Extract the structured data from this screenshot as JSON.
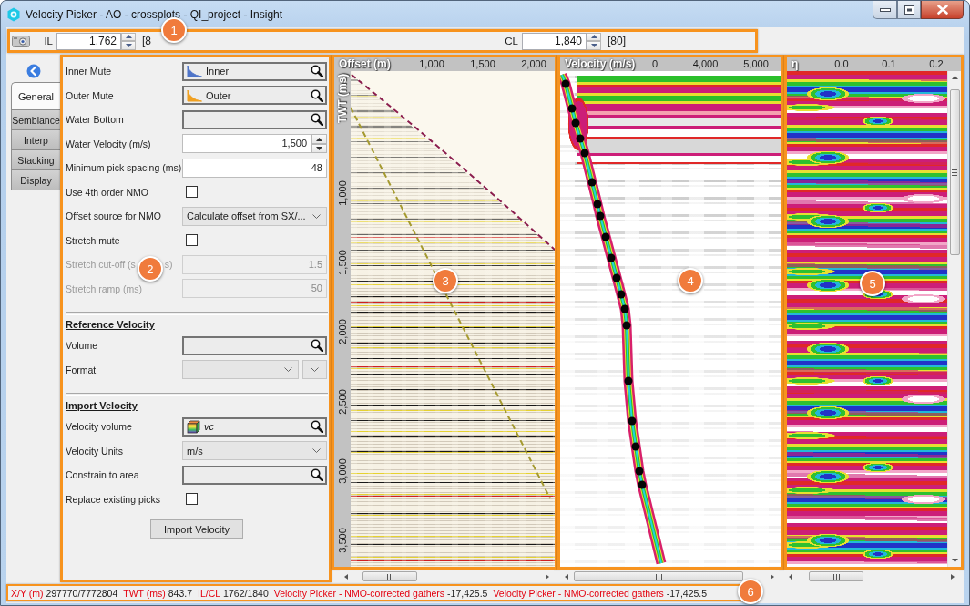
{
  "window": {
    "title": "Velocity Picker - AO - crossplots - QI_project - Insight"
  },
  "toolbar": {
    "line_fields": [
      {
        "label": "IL",
        "value": "1,762",
        "range": "[8"
      },
      {
        "label": "CL",
        "value": "1,840",
        "range": "[80]"
      }
    ]
  },
  "side_tabs": [
    {
      "label": "General",
      "selected": true
    },
    {
      "label": "Semblance",
      "selected": false
    },
    {
      "label": "Interp",
      "selected": false
    },
    {
      "label": "Stacking",
      "selected": false
    },
    {
      "label": "Display",
      "selected": false
    }
  ],
  "settings": [
    {
      "kind": "mutepicker",
      "label": "Inner Mute",
      "value": "Inner",
      "color": "#4f74c8",
      "disabled": false
    },
    {
      "kind": "mutepicker",
      "label": "Outer Mute",
      "value": "Outer",
      "color": "#f0a020",
      "disabled": false
    },
    {
      "kind": "picker",
      "label": "Water Bottom",
      "disabled": false
    },
    {
      "kind": "spin",
      "label": "Water Velocity (m/s)",
      "value": "1,500",
      "disabled": false
    },
    {
      "kind": "number",
      "label": "Minimum pick spacing (ms)",
      "value": "48",
      "disabled": false
    },
    {
      "kind": "checkbox",
      "label": "Use 4th order NMO",
      "checked": false,
      "disabled": false
    },
    {
      "kind": "dropdown",
      "label": "Offset source for NMO",
      "value": "Calculate offset from SX/...",
      "disabled": false
    },
    {
      "kind": "checkbox",
      "label": "Stretch mute",
      "checked": false,
      "disabled": false
    },
    {
      "kind": "number",
      "label": "Stretch cut-off (s",
      "callout": "2",
      "label_tail": "s)",
      "value": "1.5",
      "disabled": true
    },
    {
      "kind": "number",
      "label": "Stretch ramp (ms)",
      "value": "50",
      "disabled": true
    },
    {
      "kind": "separator"
    },
    {
      "kind": "heading",
      "label": "Reference Velocity"
    },
    {
      "kind": "picker",
      "label": "Volume",
      "disabled": false
    },
    {
      "kind": "dropdownpair",
      "label": "Format"
    },
    {
      "kind": "separator"
    },
    {
      "kind": "heading",
      "label": "Import Velocity"
    },
    {
      "kind": "volumepicker",
      "label": "Velocity volume",
      "value": "vc",
      "disabled": false
    },
    {
      "kind": "dropdown",
      "label": "Velocity Units",
      "value": "m/s",
      "disabled": false
    },
    {
      "kind": "picker",
      "label": "Constrain to area",
      "disabled": false
    },
    {
      "kind": "checkbox",
      "label": "Replace existing picks",
      "checked": false,
      "disabled": false
    },
    {
      "kind": "button",
      "label": "Import Velocity"
    }
  ],
  "gather_panel": {
    "x_label": "Offset (m)",
    "x_ticks": [
      "1,000",
      "1,500",
      "2,000"
    ],
    "y_label": "TWT (ms)",
    "y_ticks": [
      "1,000",
      "1,500",
      "2,000",
      "2,500",
      "3,000",
      "3,500"
    ]
  },
  "semblance_panel": {
    "x_label": "Velocity (m/s)",
    "x_ticks": [
      "0",
      "4,000",
      "5,000"
    ]
  },
  "eta_panel": {
    "x_label": "η",
    "x_ticks": [
      "0.0",
      "0.1",
      "0.2"
    ]
  },
  "status_bar": [
    {
      "label": "X/Y (m)",
      "value": "297770/7772804"
    },
    {
      "label": "TWT (ms)",
      "value": "843.7"
    },
    {
      "label": "IL/CL",
      "value": "1762/1840"
    },
    {
      "label": "Velocity Picker - NMO-corrected gathers",
      "value": "-17,425.5"
    },
    {
      "label": "Velocity Picker - NMO-corrected gathers",
      "value": "-17,425.5"
    }
  ],
  "callouts": [
    "1",
    "3",
    "4",
    "5",
    "6"
  ]
}
